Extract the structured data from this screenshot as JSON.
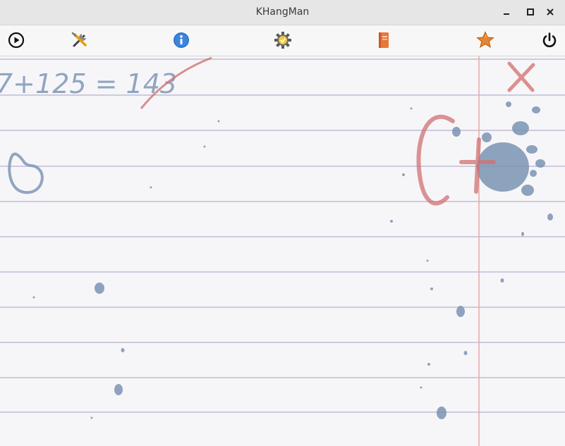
{
  "window": {
    "title": "KHangMan",
    "controls": [
      "minimize-icon",
      "maximize-icon",
      "close-icon"
    ]
  },
  "toolbar": {
    "items": [
      {
        "name": "new-game",
        "icon": "play-circle-icon"
      },
      {
        "name": "configure",
        "icon": "tools-icon"
      },
      {
        "name": "about",
        "icon": "info-icon"
      },
      {
        "name": "settings",
        "icon": "gear-icon"
      },
      {
        "name": "vocabulary",
        "icon": "book-icon"
      },
      {
        "name": "favorites",
        "icon": "star-icon"
      },
      {
        "name": "quit",
        "icon": "power-icon"
      }
    ]
  },
  "paper": {
    "doodle_equation": "7+125 = 143",
    "doodle_grade": "C+",
    "colors": {
      "ruling": "#c9c3dc",
      "margin": "#e8a0a0",
      "ink_blue": "#7a93b3",
      "ink_red": "#d06060"
    }
  }
}
